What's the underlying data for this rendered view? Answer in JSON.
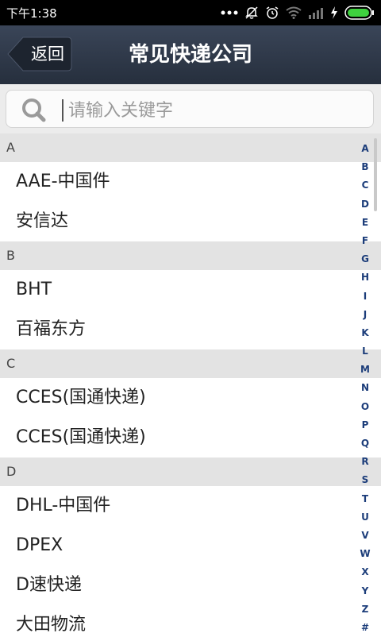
{
  "status_bar": {
    "time": "下午1:38",
    "icons": [
      "dots-icon",
      "mute-icon",
      "alarm-icon",
      "wifi-icon",
      "signal-icon",
      "charging-icon",
      "battery-icon"
    ],
    "accent": "#3fd13f"
  },
  "header": {
    "back_label": "返回",
    "title": "常见快递公司"
  },
  "search": {
    "placeholder": "请输入关键字",
    "value": ""
  },
  "sections": [
    {
      "letter": "A",
      "items": [
        "AAE-中国件",
        "安信达"
      ]
    },
    {
      "letter": "B",
      "items": [
        "BHT",
        "百福东方"
      ]
    },
    {
      "letter": "C",
      "items": [
        "CCES(国通快递)",
        "CCES(国通快递)"
      ]
    },
    {
      "letter": "D",
      "items": [
        "DHL-中国件",
        "DPEX",
        "D速快递",
        "大田物流"
      ]
    }
  ],
  "index_letters": [
    "A",
    "B",
    "C",
    "D",
    "E",
    "F",
    "G",
    "H",
    "I",
    "J",
    "K",
    "L",
    "M",
    "N",
    "O",
    "P",
    "Q",
    "R",
    "S",
    "T",
    "U",
    "V",
    "W",
    "X",
    "Y",
    "Z",
    "#"
  ],
  "colors": {
    "title_bar": "#2e3747",
    "section_header": "#e3e3e3",
    "index_letter": "#1c3d7a"
  }
}
